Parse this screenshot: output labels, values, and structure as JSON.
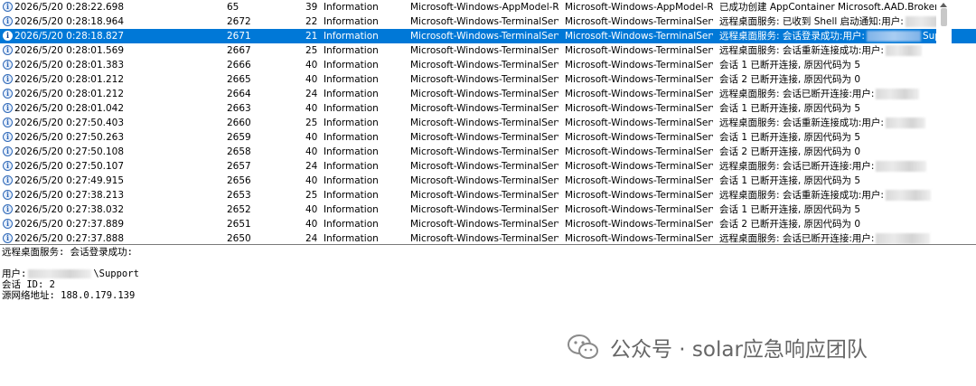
{
  "events": [
    {
      "date": "2026/5/20 0:28:22.698",
      "id": "65",
      "task": "39",
      "level": "Information",
      "source": "Microsoft-Windows-AppModel-Ru...",
      "log": "Microsoft-Windows-AppModel-Ru...",
      "general": "已成功创建 AppContainer Microsoft.AAD.BrokerPl...",
      "selected": false
    },
    {
      "date": "2026/5/20 0:28:18.964",
      "id": "2672",
      "task": "22",
      "level": "Information",
      "source": "Microsoft-Windows-TerminalServic...",
      "log": "Microsoft-Windows-TerminalServic...",
      "general": "远程桌面服务: 已收到 Shell 启动通知:用户:",
      "selected": false
    },
    {
      "date": "2026/5/20 0:28:18.827",
      "id": "2671",
      "task": "21",
      "level": "Information",
      "source": "Microsoft-Windows-TerminalServic...",
      "log": "Microsoft-Windows-TerminalServic...",
      "general": "远程桌面服务: 会话登录成功:用户:",
      "general_suffix": "Sup...",
      "selected": true
    },
    {
      "date": "2026/5/20 0:28:01.569",
      "id": "2667",
      "task": "25",
      "level": "Information",
      "source": "Microsoft-Windows-TerminalServic...",
      "log": "Microsoft-Windows-TerminalServic...",
      "general": "远程桌面服务: 会话重新连接成功:用户:",
      "selected": false
    },
    {
      "date": "2026/5/20 0:28:01.383",
      "id": "2666",
      "task": "40",
      "level": "Information",
      "source": "Microsoft-Windows-TerminalServic...",
      "log": "Microsoft-Windows-TerminalServic...",
      "general": "会话 1 已断开连接, 原因代码为 5",
      "selected": false
    },
    {
      "date": "2026/5/20 0:28:01.212",
      "id": "2665",
      "task": "40",
      "level": "Information",
      "source": "Microsoft-Windows-TerminalServic...",
      "log": "Microsoft-Windows-TerminalServic...",
      "general": "会话 2 已断开连接, 原因代码为 0",
      "selected": false
    },
    {
      "date": "2026/5/20 0:28:01.212",
      "id": "2664",
      "task": "24",
      "level": "Information",
      "source": "Microsoft-Windows-TerminalServic...",
      "log": "Microsoft-Windows-TerminalServic...",
      "general": "远程桌面服务: 会话已断开连接:用户:",
      "selected": false
    },
    {
      "date": "2026/5/20 0:28:01.042",
      "id": "2663",
      "task": "40",
      "level": "Information",
      "source": "Microsoft-Windows-TerminalServic...",
      "log": "Microsoft-Windows-TerminalServic...",
      "general": "会话 1 已断开连接, 原因代码为 5",
      "selected": false
    },
    {
      "date": "2026/5/20 0:27:50.403",
      "id": "2660",
      "task": "25",
      "level": "Information",
      "source": "Microsoft-Windows-TerminalServic...",
      "log": "Microsoft-Windows-TerminalServic...",
      "general": "远程桌面服务: 会话重新连接成功:用户:",
      "selected": false
    },
    {
      "date": "2026/5/20 0:27:50.263",
      "id": "2659",
      "task": "40",
      "level": "Information",
      "source": "Microsoft-Windows-TerminalServic...",
      "log": "Microsoft-Windows-TerminalServic...",
      "general": "会话 1 已断开连接, 原因代码为 5",
      "selected": false
    },
    {
      "date": "2026/5/20 0:27:50.108",
      "id": "2658",
      "task": "40",
      "level": "Information",
      "source": "Microsoft-Windows-TerminalServic...",
      "log": "Microsoft-Windows-TerminalServic...",
      "general": "会话 2 已断开连接, 原因代码为 0",
      "selected": false
    },
    {
      "date": "2026/5/20 0:27:50.107",
      "id": "2657",
      "task": "24",
      "level": "Information",
      "source": "Microsoft-Windows-TerminalServic...",
      "log": "Microsoft-Windows-TerminalServic...",
      "general": "远程桌面服务: 会话已断开连接:用户:",
      "selected": false
    },
    {
      "date": "2026/5/20 0:27:49.915",
      "id": "2656",
      "task": "40",
      "level": "Information",
      "source": "Microsoft-Windows-TerminalServic...",
      "log": "Microsoft-Windows-TerminalServic...",
      "general": "会话 1 已断开连接, 原因代码为 5",
      "selected": false
    },
    {
      "date": "2026/5/20 0:27:38.213",
      "id": "2653",
      "task": "25",
      "level": "Information",
      "source": "Microsoft-Windows-TerminalServic...",
      "log": "Microsoft-Windows-TerminalServic...",
      "general": "远程桌面服务: 会话重新连接成功:用户:",
      "selected": false
    },
    {
      "date": "2026/5/20 0:27:38.032",
      "id": "2652",
      "task": "40",
      "level": "Information",
      "source": "Microsoft-Windows-TerminalServic...",
      "log": "Microsoft-Windows-TerminalServic...",
      "general": "会话 1 已断开连接, 原因代码为 5",
      "selected": false
    },
    {
      "date": "2026/5/20 0:27:37.889",
      "id": "2651",
      "task": "40",
      "level": "Information",
      "source": "Microsoft-Windows-TerminalServic...",
      "log": "Microsoft-Windows-TerminalServic...",
      "general": "会话 2 已断开连接, 原因代码为 0",
      "selected": false
    },
    {
      "date": "2026/5/20 0:27:37.888",
      "id": "2650",
      "task": "24",
      "level": "Information",
      "source": "Microsoft-Windows-TerminalServic...",
      "log": "Microsoft-Windows-TerminalServic...",
      "general": "远程桌面服务: 会话已断开连接:用户:",
      "selected": false
    }
  ],
  "detail": {
    "title": "远程桌面服务: 会话登录成功:",
    "user_label": "用户:",
    "user_suffix": "\\Support",
    "session_line": "会话 ID: 2",
    "source_line": "源网络地址: 188.0.179.139"
  },
  "watermark": {
    "text": "公众号 · solar应急响应团队",
    "icon": "wechat-icon"
  },
  "colors": {
    "selection": "#0078d7",
    "info_icon": "#2e68b8",
    "watermark": "#666666"
  }
}
